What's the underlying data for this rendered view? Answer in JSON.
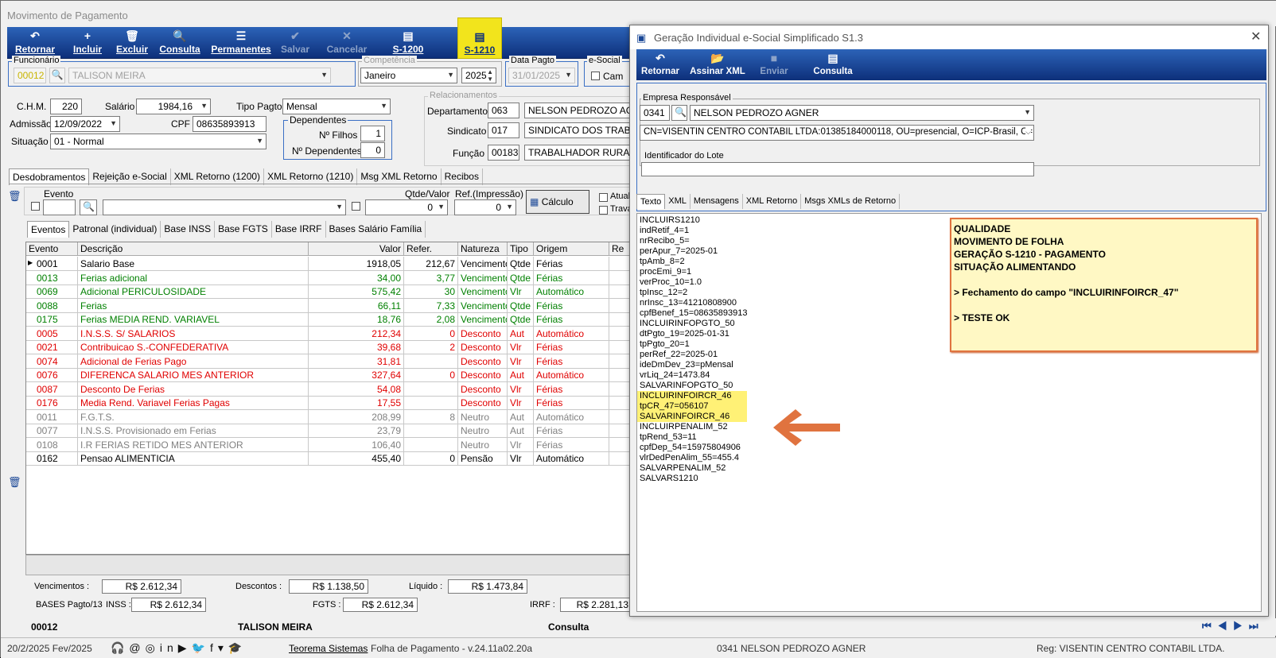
{
  "main": {
    "title": "Movimento de Pagamento",
    "toolbar": [
      {
        "label": "Retornar",
        "icon": "↶",
        "state": "normal"
      },
      {
        "label": "Incluir",
        "icon": "+",
        "state": "normal"
      },
      {
        "label": "Excluir",
        "icon": "🗑",
        "state": "normal"
      },
      {
        "label": "Consulta",
        "icon": "🔍",
        "state": "normal"
      },
      {
        "label": "Permanentes",
        "icon": "☰",
        "state": "normal"
      },
      {
        "label": "Salvar",
        "icon": "✔",
        "state": "disabled"
      },
      {
        "label": "Cancelar",
        "icon": "✕",
        "state": "disabled"
      },
      {
        "label": "S-1200",
        "icon": "▤",
        "state": "normal"
      },
      {
        "label": "S-1210",
        "icon": "▤",
        "state": "highlighted"
      }
    ],
    "funcionario": {
      "label": "Funcionário",
      "code": "00012",
      "name": "TALISON MEIRA"
    },
    "competencia": {
      "label": "Competência",
      "month": "Janeiro",
      "year": "2025"
    },
    "data_pagto": {
      "label": "Data Pagto",
      "value": "31/01/2025"
    },
    "esocial": {
      "label": "e-Social",
      "check_label": "Cam"
    },
    "chm": {
      "label": "C.H.M.",
      "value": "220"
    },
    "salario": {
      "label": "Salário",
      "value": "1984,16"
    },
    "tipo_pagto": {
      "label": "Tipo Pagto",
      "value": "Mensal"
    },
    "admissao": {
      "label": "Admissão",
      "value": "12/09/2022"
    },
    "cpf": {
      "label": "CPF",
      "value": "08635893913"
    },
    "situacao": {
      "label": "Situação",
      "value": "01 - Normal"
    },
    "dependentes": {
      "label": "Dependentes",
      "filhos_label": "Nº Filhos",
      "filhos": "1",
      "dep_label": "Nº Dependentes",
      "dep": "0"
    },
    "relacionamentos": {
      "label": "Relacionamentos",
      "departamento": {
        "label": "Departamento",
        "code": "063",
        "name": "NELSON PEDROZO AGNER"
      },
      "sindicato": {
        "label": "Sindicato",
        "code": "017",
        "name": "SINDICATO DOS TRABAL"
      },
      "funcao": {
        "label": "Função",
        "code": "00183",
        "name": "TRABALHADOR RURAL"
      }
    },
    "tabs": [
      "Desdobramentos",
      "Rejeição e-Social",
      "XML Retorno (1200)",
      "XML Retorno (1210)",
      "Msg XML Retorno",
      "Recibos"
    ],
    "evento_filter": {
      "label": "Evento",
      "qtde_label": "Qtde/Valor",
      "qtde": "0",
      "ref_label": "Ref.(Impressão)",
      "ref": "0",
      "calc_button": "Cálculo",
      "atual": "Atuali",
      "trava": "Trava"
    },
    "subtabs": [
      "Eventos",
      "Patronal (individual)",
      "Base INSS",
      "Base FGTS",
      "Base IRRF",
      "Bases Salário Família"
    ],
    "grid_headers": [
      "Evento",
      "Descrição",
      "Valor",
      "Refer.",
      "Natureza",
      "Tipo",
      "Origem",
      "Re"
    ],
    "rows": [
      {
        "ev": "0001",
        "desc": "Salario Base",
        "valor": "1918,05",
        "ref": "212,67",
        "nat": "Vencimento",
        "tipo": "Qtde",
        "orig": "Férias",
        "color": "#000000"
      },
      {
        "ev": "0013",
        "desc": "Ferias adicional",
        "valor": "34,00",
        "ref": "3,77",
        "nat": "Vencimento",
        "tipo": "Qtde",
        "orig": "Férias",
        "color": "#008000"
      },
      {
        "ev": "0069",
        "desc": "Adicional PERICULOSIDADE",
        "valor": "575,42",
        "ref": "30",
        "nat": "Vencimento",
        "tipo": "Vlr",
        "orig": "Automático",
        "color": "#008000"
      },
      {
        "ev": "0088",
        "desc": "Ferias",
        "valor": "66,11",
        "ref": "7,33",
        "nat": "Vencimento",
        "tipo": "Qtde",
        "orig": "Férias",
        "color": "#008000"
      },
      {
        "ev": "0175",
        "desc": "Ferias MEDIA REND. VARIAVEL",
        "valor": "18,76",
        "ref": "2,08",
        "nat": "Vencimento",
        "tipo": "Qtde",
        "orig": "Férias",
        "color": "#008000"
      },
      {
        "ev": "0005",
        "desc": "I.N.S.S. S/ SALARIOS",
        "valor": "212,34",
        "ref": "0",
        "nat": "Desconto",
        "tipo": "Aut",
        "orig": "Automático",
        "color": "#e00000"
      },
      {
        "ev": "0021",
        "desc": "Contribuicao S.-CONFEDERATIVA",
        "valor": "39,68",
        "ref": "2",
        "nat": "Desconto",
        "tipo": "Vlr",
        "orig": "Férias",
        "color": "#e00000"
      },
      {
        "ev": "0074",
        "desc": "Adicional de Ferias Pago",
        "valor": "31,81",
        "ref": "",
        "nat": "Desconto",
        "tipo": "Vlr",
        "orig": "Férias",
        "color": "#e00000"
      },
      {
        "ev": "0076",
        "desc": "DIFERENCA SALARIO MES ANTERIOR",
        "valor": "327,64",
        "ref": "0",
        "nat": "Desconto",
        "tipo": "Aut",
        "orig": "Automático",
        "color": "#e00000"
      },
      {
        "ev": "0087",
        "desc": "Desconto De Ferias",
        "valor": "54,08",
        "ref": "",
        "nat": "Desconto",
        "tipo": "Vlr",
        "orig": "Férias",
        "color": "#e00000"
      },
      {
        "ev": "0176",
        "desc": "Media  Rend. Variavel Ferias Pagas",
        "valor": "17,55",
        "ref": "",
        "nat": "Desconto",
        "tipo": "Vlr",
        "orig": "Férias",
        "color": "#e00000"
      },
      {
        "ev": "0011",
        "desc": "F.G.T.S.",
        "valor": "208,99",
        "ref": "8",
        "nat": "Neutro",
        "tipo": "Aut",
        "orig": "Automático",
        "color": "#808080"
      },
      {
        "ev": "0077",
        "desc": "I.N.S.S. Provisionado em Ferias",
        "valor": "23,79",
        "ref": "",
        "nat": "Neutro",
        "tipo": "Aut",
        "orig": "Férias",
        "color": "#808080"
      },
      {
        "ev": "0108",
        "desc": "I.R FERIAS RETIDO MES ANTERIOR",
        "valor": "106,40",
        "ref": "",
        "nat": "Neutro",
        "tipo": "Vlr",
        "orig": "Férias",
        "color": "#808080"
      },
      {
        "ev": "0162",
        "desc": "Pensao ALIMENTICIA",
        "valor": "455,40",
        "ref": "0",
        "nat": "Pensão",
        "tipo": "Vlr",
        "orig": "Automático",
        "color": "#000000"
      }
    ],
    "totals": {
      "venc_label": "Vencimentos :",
      "venc": "R$ 2.612,34",
      "desc_label": "Descontos  :",
      "desc": "R$ 1.138,50",
      "liq_label": "Líquido :",
      "liq": "R$ 1.473,84",
      "bases_label": "BASES Pagto/13",
      "inss_label": "INSS :",
      "inss": "R$ 2.612,34",
      "fgts_label": "FGTS :",
      "fgts": "R$ 2.612,34",
      "irrf_label": "IRRF :",
      "irrf": "R$ 2.281,13"
    },
    "status": {
      "code": "00012",
      "name": "TALISON MEIRA",
      "mode": "Consulta"
    },
    "footer": {
      "date": "20/2/2025 Fev/2025",
      "company_link": "Teorema Sistemas",
      "version": "Folha de Pagamento - v.24.11a02.20a",
      "empresa": "0341 NELSON PEDROZO AGNER",
      "reg": "Reg: VISENTIN CENTRO CONTABIL LTDA."
    }
  },
  "sub": {
    "title": "Geração Individual e-Social Simplificado S1.3",
    "toolbar": [
      {
        "label": "Retornar",
        "icon": "↶",
        "state": "normal"
      },
      {
        "label": "Assinar XML",
        "icon": "📂",
        "state": "normal"
      },
      {
        "label": "Enviar",
        "icon": "■",
        "state": "disabled"
      },
      {
        "label": "Consulta",
        "icon": "▤",
        "state": "normal"
      }
    ],
    "empresa": {
      "label": "Empresa Responsável",
      "code": "0341",
      "name": "NELSON PEDROZO AGNER"
    },
    "certificado": "CN=VISENTIN CENTRO CONTABIL LTDA:01385184000118, OU=presencial, O=ICP-Brasil, C=BR, S",
    "lote_label": "Identificador do Lote",
    "tabs": [
      "Texto",
      "XML",
      "Mensagens",
      "XML Retorno",
      "Msgs XMLs de Retorno"
    ],
    "text_lines": [
      "INCLUIRS1210",
      "indRetif_4=1",
      "nrRecibo_5=",
      "perApur_7=2025-01",
      "tpAmb_8=2",
      "procEmi_9=1",
      "verProc_10=1.0",
      "tpInsc_12=2",
      "nrInsc_13=41210808900",
      "cpfBenef_15=08635893913",
      "INCLUIRINFOPGTO_50",
      "dtPgto_19=2025-01-31",
      "tpPgto_20=1",
      "perRef_22=2025-01",
      "ideDmDev_23=pMensal",
      "vrLiq_24=1473.84",
      "SALVARINFOPGTO_50",
      "INCLUIRINFOIRCR_46",
      "tpCR_47=056107",
      "SALVARINFOIRCR_46",
      "INCLUIRPENALIM_52",
      "tpRend_53=11",
      "cpfDep_54=15975804906",
      "vlrDedPenAlim_55=455.4",
      "SALVARPENALIM_52",
      "SALVARS1210"
    ],
    "note_lines": [
      "QUALIDADE",
      "MOVIMENTO DE FOLHA",
      "GERAÇÃO S-1210 - PAGAMENTO",
      "SITUAÇÃO ALIMENTANDO",
      "",
      "> Fechamento do campo \"INCLUIRINFOIRCR_47\"",
      "",
      "> TESTE OK"
    ]
  },
  "colors": {
    "toolbar": "#1a4796",
    "highlight": "#f2e41c",
    "arrow": "#e0733f",
    "note_bg": "#fff8c4"
  }
}
